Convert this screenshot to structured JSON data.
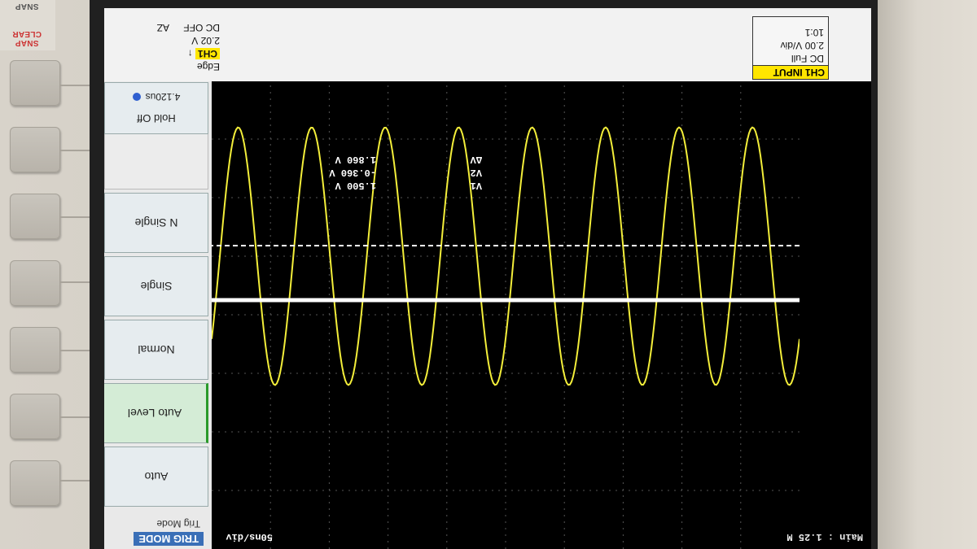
{
  "bezel": {
    "snap_label": "SNAP",
    "snap_clear_label": "SNAP CLEAR"
  },
  "status": {
    "ch_input_label": "CH1 INPUT",
    "coupling": "DC Full",
    "scale": "2.00 V/div",
    "probe": "10:1",
    "trigger_type": "Edge",
    "trigger_channel": "CH1",
    "trigger_level": "2.02 V",
    "trigger_coupling": "DC OFF",
    "trigger_extra": "AZ"
  },
  "menu": {
    "title": "TRIG MODE",
    "subtitle": "Trig Mode",
    "buttons": [
      "Auto",
      "Auto Level",
      "Normal",
      "Single",
      "N Single"
    ],
    "active_index": 1,
    "holdoff_title": "Hold Off",
    "holdoff_value": "4.120us",
    "partial_value": "4.120us"
  },
  "timebase": {
    "per_div": "50ns/div",
    "main_rate": "Main : 1.25 M"
  },
  "cursors": {
    "v1_label": "V1",
    "v1_value": "1.500 V",
    "v2_label": "V2",
    "v2_value": "-0.360 V",
    "dv_label": "ΔV",
    "dv_value": "1.860 V"
  },
  "colors": {
    "trace": "#f3ee3a",
    "grid": "#555555",
    "cursor": "#ffffff",
    "menu_title_bg": "#3a6fb7"
  },
  "waveform": {
    "cycles_shown": 8.0,
    "amplitude_div": 2.2,
    "offset_div": 0.0,
    "phase_deg": 40
  }
}
